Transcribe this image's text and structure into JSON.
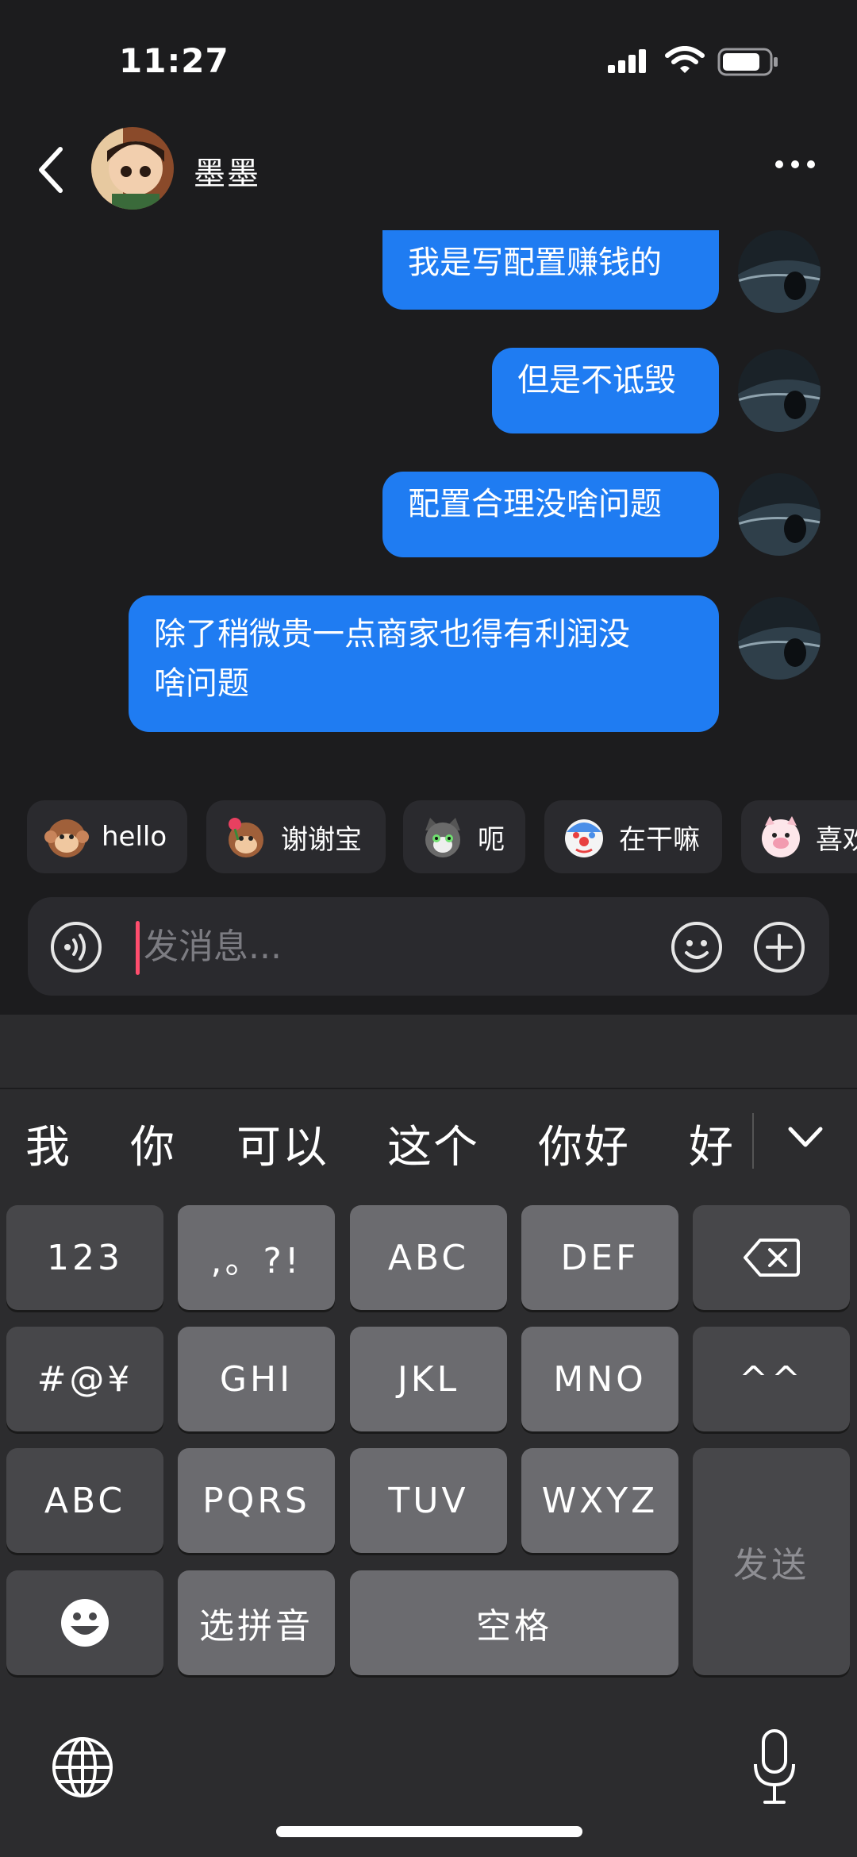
{
  "status": {
    "time": "11:27"
  },
  "header": {
    "contact_name": "墨墨"
  },
  "messages": [
    {
      "text": "我是写配置赚钱的"
    },
    {
      "text": "但是不诋毁"
    },
    {
      "text": "配置合理没啥问题"
    },
    {
      "text": "除了稍微贵一点商家也得有利润没啥问题",
      "line1": "除了稍微贵一点商家也得有利润没",
      "line2": "啥问题"
    }
  ],
  "quick_replies": [
    {
      "label": "hello",
      "icon": "monkey-sticker-icon"
    },
    {
      "label": "谢谢宝",
      "icon": "monkey-flower-sticker-icon"
    },
    {
      "label": "呃",
      "icon": "cat-sticker-icon"
    },
    {
      "label": "在干嘛",
      "icon": "clown-sticker-icon"
    },
    {
      "label": "喜欢",
      "icon": "pig-sticker-icon"
    }
  ],
  "input": {
    "placeholder": "发消息..."
  },
  "keyboard": {
    "candidates": [
      "我",
      "你",
      "可以",
      "这个",
      "你好",
      "好"
    ],
    "rows": [
      [
        "123",
        ",。?!",
        "ABC",
        "DEF"
      ],
      [
        "#@¥",
        "GHI",
        "JKL",
        "MNO",
        "^^"
      ],
      [
        "ABC",
        "PQRS",
        "TUV",
        "WXYZ"
      ],
      [
        "选拼音",
        "空格"
      ]
    ],
    "send_label": "发送"
  },
  "colors": {
    "bubble": "#1f7cf2",
    "caret": "#ff4d6d",
    "background": "#1c1c1e"
  }
}
